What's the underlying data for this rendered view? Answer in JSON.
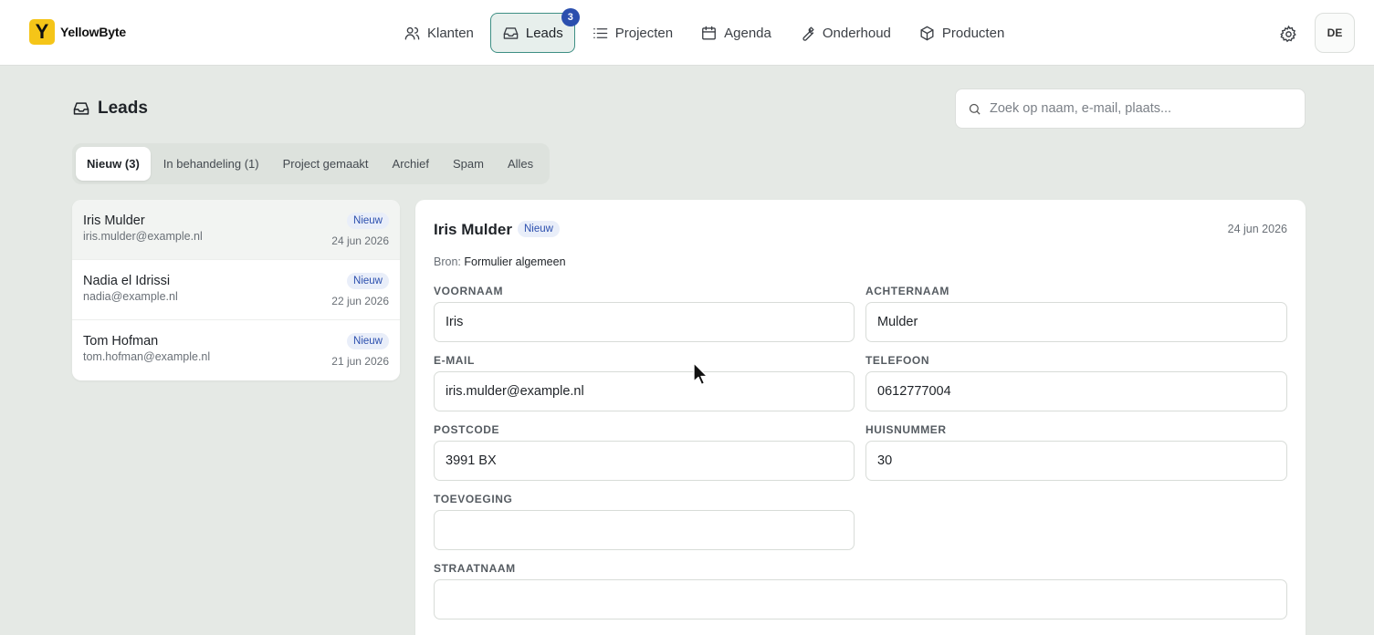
{
  "brand": {
    "logo_letter": "Y",
    "name": "YellowByte",
    "color": "#f5c518"
  },
  "nav": {
    "items": [
      {
        "label": "Klanten",
        "icon": "users-icon"
      },
      {
        "label": "Leads",
        "icon": "inbox-icon",
        "badge": "3",
        "active": true
      },
      {
        "label": "Projecten",
        "icon": "list-icon"
      },
      {
        "label": "Agenda",
        "icon": "calendar-icon"
      },
      {
        "label": "Onderhoud",
        "icon": "wrench-icon"
      },
      {
        "label": "Producten",
        "icon": "box-icon"
      }
    ],
    "settings_icon": "gear-icon",
    "avatar_initials": "DE"
  },
  "page": {
    "title": "Leads",
    "search_placeholder": "Zoek op naam, e-mail, plaats..."
  },
  "tabs": [
    {
      "label": "Nieuw (3)",
      "active": true
    },
    {
      "label": "In behandeling (1)"
    },
    {
      "label": "Project gemaakt"
    },
    {
      "label": "Archief"
    },
    {
      "label": "Spam"
    },
    {
      "label": "Alles"
    }
  ],
  "leads": [
    {
      "name": "Iris Mulder",
      "email": "iris.mulder@example.nl",
      "status": "Nieuw",
      "date": "24 jun 2026",
      "selected": true
    },
    {
      "name": "Nadia el Idrissi",
      "email": "nadia@example.nl",
      "status": "Nieuw",
      "date": "22 jun 2026"
    },
    {
      "name": "Tom Hofman",
      "email": "tom.hofman@example.nl",
      "status": "Nieuw",
      "date": "21 jun 2026"
    }
  ],
  "detail": {
    "name": "Iris Mulder",
    "status": "Nieuw",
    "date": "24 jun 2026",
    "source_label": "Bron:",
    "source_value": "Formulier algemeen",
    "fields": {
      "voornaam": {
        "label": "VOORNAAM",
        "value": "Iris"
      },
      "achternaam": {
        "label": "ACHTERNAAM",
        "value": "Mulder"
      },
      "email": {
        "label": "E-MAIL",
        "value": "iris.mulder@example.nl"
      },
      "telefoon": {
        "label": "TELEFOON",
        "value": "0612777004"
      },
      "postcode": {
        "label": "POSTCODE",
        "value": "3991 BX"
      },
      "huisnummer": {
        "label": "HUISNUMMER",
        "value": "30"
      },
      "toevoeging": {
        "label": "TOEVOEGING",
        "value": ""
      },
      "straatnaam": {
        "label": "STRAATNAAM",
        "value": ""
      }
    }
  },
  "colors": {
    "accent": "#3e8f84",
    "badge_blue": "#2b4fae",
    "background": "#e5e9e5"
  }
}
